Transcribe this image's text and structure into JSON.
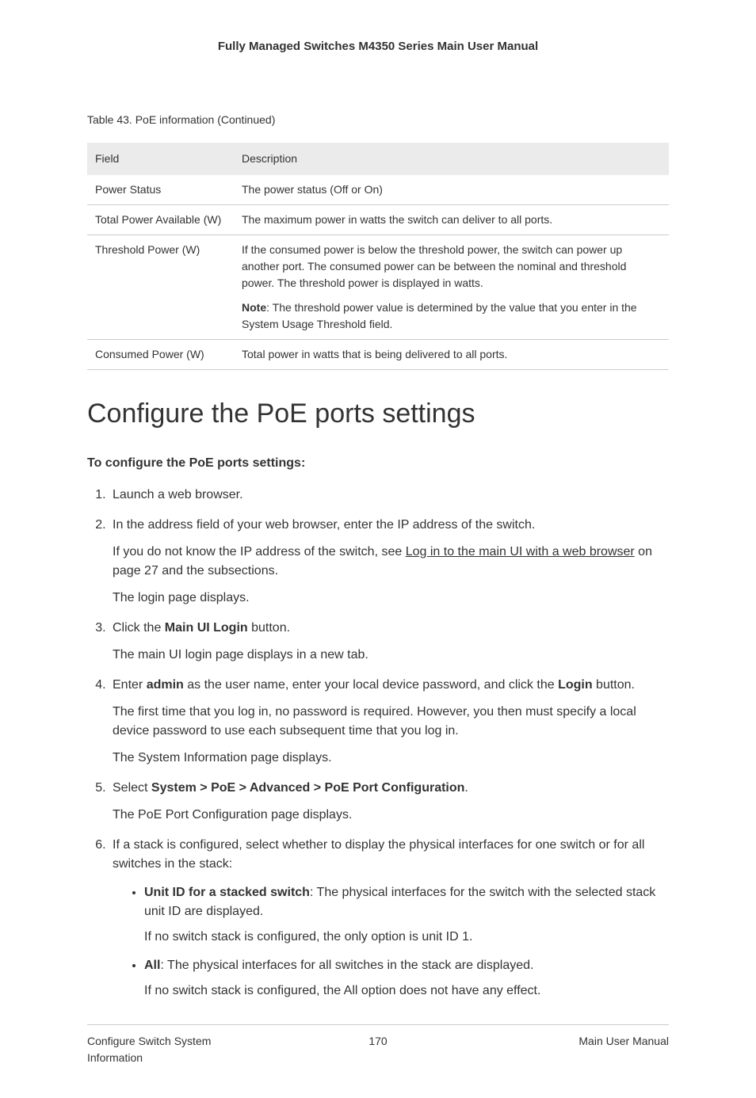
{
  "header": {
    "title": "Fully Managed Switches M4350 Series Main User Manual"
  },
  "table": {
    "caption": "Table 43. PoE information (Continued)",
    "head": {
      "field": "Field",
      "description": "Description"
    },
    "rows": [
      {
        "field": "Power Status",
        "description": "The power status (Off or On)"
      },
      {
        "field": "Total Power Available (W)",
        "description": "The maximum power in watts the switch can deliver to all ports."
      },
      {
        "field": "Threshold Power (W)",
        "description": "If the consumed power is below the threshold power, the switch can power up another port. The consumed power can be between the nominal and threshold power. The threshold power is displayed in watts.",
        "note_label": "Note",
        "note_text": ": The threshold power value is determined by the value that you enter in the System Usage Threshold field."
      },
      {
        "field": "Consumed Power (W)",
        "description": "Total power in watts that is being delivered to all ports."
      }
    ]
  },
  "section": {
    "heading": "Configure the PoE ports settings",
    "intro": "To configure the PoE ports settings:"
  },
  "steps": {
    "s1": "Launch a web browser.",
    "s2": "In the address field of your web browser, enter the IP address of the switch.",
    "s2_p_pre": "If you do not know the IP address of the switch, see ",
    "s2_link": "Log in to the main UI with a web browser",
    "s2_p_post": " on page 27 and the subsections.",
    "s2_p2": "The login page displays.",
    "s3_pre": "Click the ",
    "s3_bold": "Main UI Login",
    "s3_post": " button.",
    "s3_p": "The main UI login page displays in a new tab.",
    "s4_pre": "Enter ",
    "s4_bold1": "admin",
    "s4_mid": " as the user name, enter your local device password, and click the ",
    "s4_bold2": "Login",
    "s4_post": " button.",
    "s4_p1": "The first time that you log in, no password is required. However, you then must specify a local device password to use each subsequent time that you log in.",
    "s4_p2": "The System Information page displays.",
    "s5_pre": "Select ",
    "s5_bold": "System > PoE > Advanced > PoE Port Configuration",
    "s5_post": ".",
    "s5_p": "The PoE Port Configuration page displays.",
    "s6": "If a stack is configured, select whether to display the physical interfaces for one switch or for all switches in the stack:",
    "s6_b1_bold": "Unit ID for a stacked switch",
    "s6_b1_text": ": The physical interfaces for the switch with the selected stack unit ID are displayed.",
    "s6_b1_p": "If no switch stack is configured, the only option is unit ID 1.",
    "s6_b2_bold": "All",
    "s6_b2_text": ": The physical interfaces for all switches in the stack are displayed.",
    "s6_b2_p": "If no switch stack is configured, the All option does not have any effect."
  },
  "footer": {
    "left": "Configure Switch System Information",
    "center": "170",
    "right": "Main User Manual"
  }
}
